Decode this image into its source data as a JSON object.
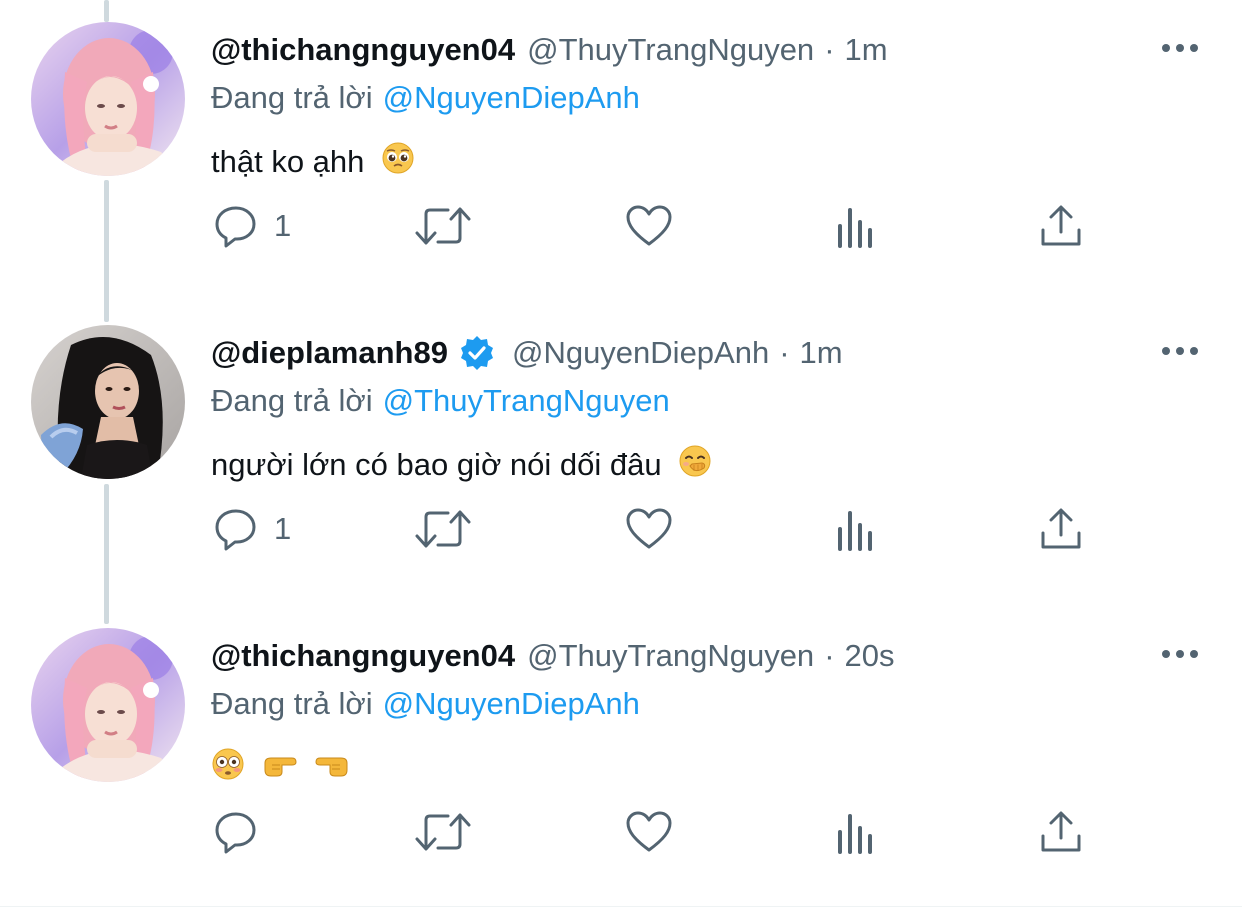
{
  "colors": {
    "text": "#0f1419",
    "secondary": "#536471",
    "link": "#1d9bf0",
    "thread_line": "#cfd9de",
    "verified": "#1d9bf0"
  },
  "tweets": [
    {
      "display_name": "@thichangnguyen04",
      "handle": "@ThuyTrangNguyen",
      "separator": "·",
      "time": "1m",
      "verified": false,
      "reply_prefix": "Đang trả lời",
      "reply_target": "@NguyenDiepAnh",
      "text": "thật ko ạhh",
      "emoji": "pleading-face",
      "reply_count": "1",
      "avatar": "pink-hair-avatar"
    },
    {
      "display_name": "@dieplamanh89",
      "handle": "@NguyenDiepAnh",
      "separator": "·",
      "time": "1m",
      "verified": true,
      "reply_prefix": "Đang trả lời",
      "reply_target": "@ThuyTrangNguyen",
      "text": "người lớn có bao giờ nói dối đâu",
      "emoji": "face-with-hand-over-mouth",
      "reply_count": "1",
      "avatar": "dark-hair-avatar"
    },
    {
      "display_name": "@thichangnguyen04",
      "handle": "@ThuyTrangNguyen",
      "separator": "·",
      "time": "20s",
      "verified": false,
      "reply_prefix": "Đang trả lời",
      "reply_target": "@NguyenDiepAnh",
      "text": "",
      "emoji": "flushed-face pointing-right pointing-left",
      "reply_count": "",
      "avatar": "pink-hair-avatar"
    }
  ]
}
